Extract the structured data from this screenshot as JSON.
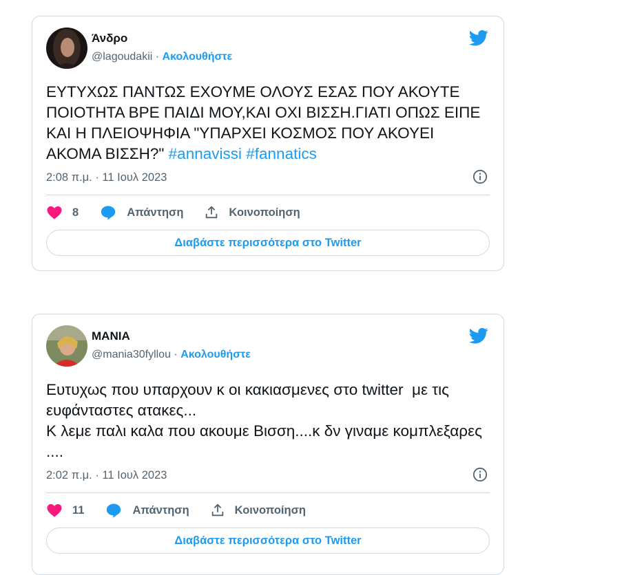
{
  "colors": {
    "accent": "#1d9bf0",
    "like": "#f91880",
    "muted": "#536471",
    "border": "#cfd9de"
  },
  "tweets": [
    {
      "name": "Άνδρο",
      "handle": "@lagoudakii",
      "separator": "·",
      "follow_label": "Ακολουθήστε",
      "text": "ΕΥΤΥΧΩΣ ΠΑΝΤΩΣ ΕΧΟΥΜΕ ΟΛΟΥΣ ΕΣΑΣ ΠΟΥ ΑΚΟΥΤΕ ΠΟΙΟΤΗΤΑ ΒΡΕ ΠΑΙΔΙ ΜΟΥ,ΚΑΙ ΟΧΙ ΒΙΣΣΗ.ΓΙΑΤΙ ΟΠΩΣ ΕΙΠΕ ΚΑΙ Η ΠΛΕΙΟΨΗΦΙΑ \"ΥΠΑΡΧΕΙ ΚΟΣΜΟΣ ΠΟΥ ΑΚΟΥΕΙ ΑΚΟΜΑ ΒΙΣΣΗ?\" ",
      "hashtags": [
        "#annavissi",
        "#fannatics"
      ],
      "timestamp": "2:08 π.μ. · 11 Ιουλ 2023",
      "likes": "8",
      "reply_label": "Απάντηση",
      "share_label": "Κοινοποίηση",
      "read_more_label": "Διαβάστε περισσότερα στο Twitter"
    },
    {
      "name": "ΜΑΝΙΑ",
      "handle": "@mania30fyllou",
      "separator": "·",
      "follow_label": "Ακολουθήστε",
      "text": "Ευτυχως που υπαρχουν κ οι κακιασμενες στο twitter  με τις ευφάνταστες ατακες...\nΚ λεμε παλι καλα που ακουμε Βισση....κ δν γιναμε κομπλεξαρες ....",
      "timestamp": "2:02 π.μ. · 11 Ιουλ 2023",
      "likes": "11",
      "reply_label": "Απάντηση",
      "share_label": "Κοινοποίηση",
      "read_more_label": "Διαβάστε περισσότερα στο Twitter"
    }
  ]
}
